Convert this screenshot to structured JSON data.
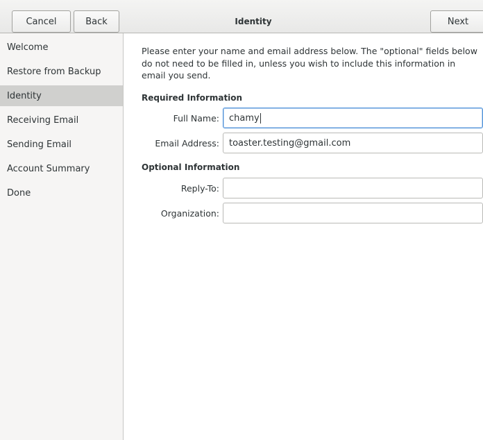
{
  "header": {
    "cancel_label": "Cancel",
    "back_label": "Back",
    "title": "Identity",
    "next_label": "Next"
  },
  "sidebar": {
    "items": [
      {
        "label": "Welcome"
      },
      {
        "label": "Restore from Backup"
      },
      {
        "label": "Identity",
        "selected": true
      },
      {
        "label": "Receiving Email"
      },
      {
        "label": "Sending Email"
      },
      {
        "label": "Account Summary"
      },
      {
        "label": "Done"
      }
    ]
  },
  "main": {
    "description": "Please enter your name and email address below. The \"optional\" fields below do not need to be filled in, unless you wish to include this information in email you send.",
    "required_heading": "Required Information",
    "optional_heading": "Optional Information",
    "fields": {
      "full_name": {
        "label": "Full Name:",
        "value": "chamy"
      },
      "email": {
        "label": "Email Address:",
        "value": "toaster.testing@gmail.com"
      },
      "reply_to": {
        "label": "Reply-To:",
        "value": ""
      },
      "organization": {
        "label": "Organization:",
        "value": ""
      }
    }
  },
  "colors": {
    "selected_row": "#d0d0ce",
    "focus_border": "#4a90d9",
    "sidebar_bg": "#f6f5f4"
  }
}
